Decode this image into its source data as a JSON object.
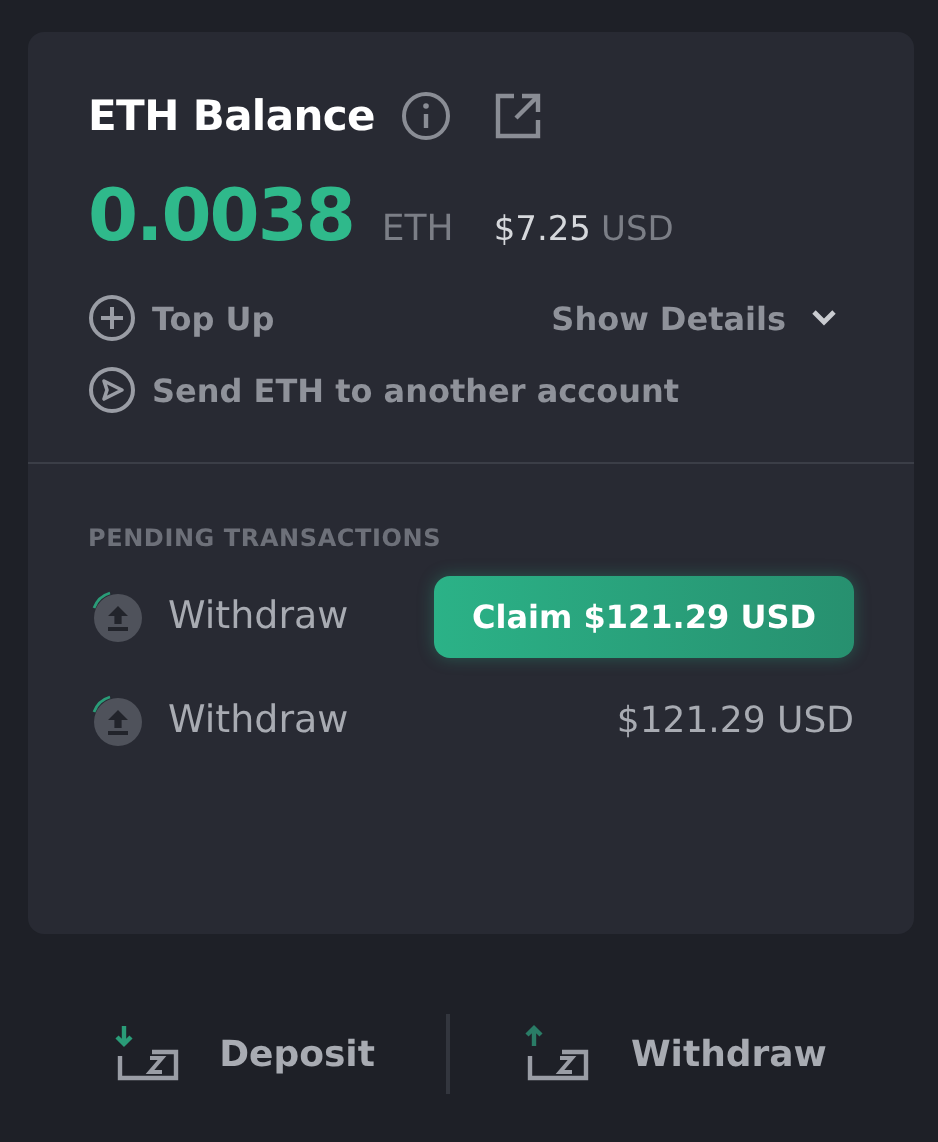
{
  "card": {
    "title": "ETH Balance",
    "amount": "0.0038",
    "unit": "ETH",
    "usd_value": "$7.25",
    "usd_unit": "USD",
    "actions": [
      {
        "kind": "top_up",
        "label": "Top Up"
      },
      {
        "kind": "send",
        "label": "Send ETH to another account"
      }
    ],
    "details_toggle": {
      "label": "Show Details",
      "expanded": false
    },
    "pending": {
      "heading": "PENDING TRANSACTIONS",
      "items": [
        {
          "label": "Withdraw",
          "kind": "claim",
          "text": "Claim $121.29 USD"
        },
        {
          "label": "Withdraw",
          "kind": "amount",
          "text": "$121.29 USD"
        }
      ]
    }
  },
  "footer": [
    {
      "kind": "deposit",
      "label": "Deposit"
    },
    {
      "kind": "withdraw",
      "label": "Withdraw"
    }
  ]
}
